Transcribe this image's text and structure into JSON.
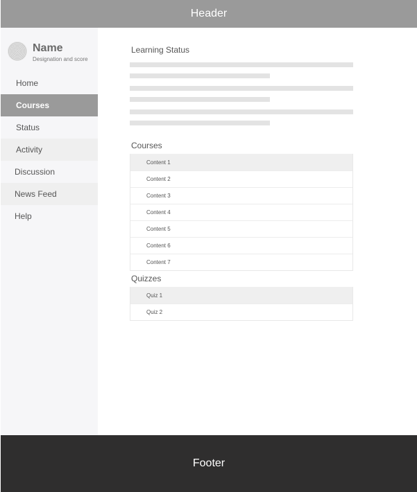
{
  "header": {
    "title": "Header"
  },
  "profile": {
    "name": "Name",
    "subtitle": "Designation and score"
  },
  "nav": {
    "items": [
      {
        "label": "Home"
      },
      {
        "label": "Courses"
      },
      {
        "label": "Status"
      },
      {
        "label": "Activity"
      },
      {
        "label": "Discussion"
      },
      {
        "label": "News Feed"
      },
      {
        "label": "Help"
      }
    ],
    "active": "Courses"
  },
  "main": {
    "learning_status": {
      "title": "Learning Status"
    },
    "courses": {
      "title": "Courses",
      "items": [
        "Content 1",
        "Content  2",
        "Content  3",
        "Content  4",
        "Content  5",
        "Content  6",
        "Content  7"
      ]
    },
    "quizzes": {
      "title": "Quizzes",
      "items": [
        "Quiz 1",
        "Quiz 2"
      ]
    }
  },
  "footer": {
    "title": "Footer"
  }
}
